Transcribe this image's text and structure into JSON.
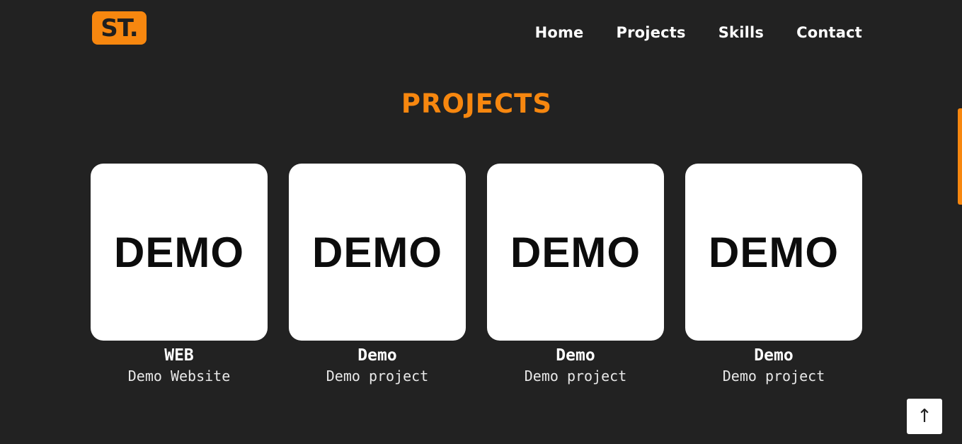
{
  "logo": {
    "text": "ST."
  },
  "nav": {
    "items": [
      {
        "label": "Home"
      },
      {
        "label": "Projects"
      },
      {
        "label": "Skills"
      },
      {
        "label": "Contact"
      }
    ]
  },
  "section": {
    "title": "PROJECTS"
  },
  "projects": [
    {
      "image_text": "DEMO",
      "title": "WEB",
      "description": "Demo Website"
    },
    {
      "image_text": "DEMO",
      "title": "Demo",
      "description": "Demo project"
    },
    {
      "image_text": "DEMO",
      "title": "Demo",
      "description": "Demo project"
    },
    {
      "image_text": "DEMO",
      "title": "Demo",
      "description": "Demo project"
    }
  ],
  "back_to_top": {
    "icon": "arrow-up-icon",
    "glyph": "↑"
  },
  "colors": {
    "background": "#222222",
    "accent": "#f7870f",
    "card_bg": "#ffffff",
    "text": "#ffffff"
  }
}
